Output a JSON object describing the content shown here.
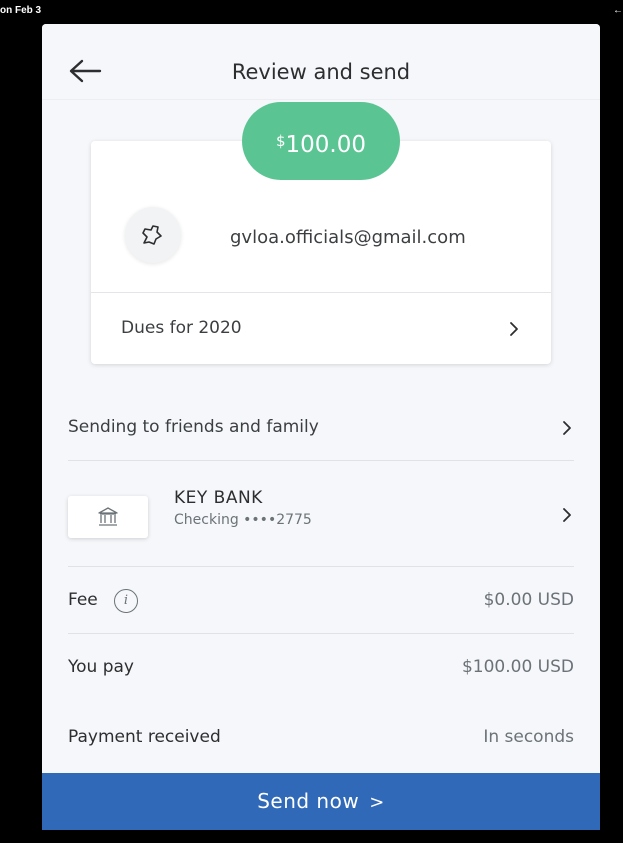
{
  "status_bar": {
    "left": "on Feb 3",
    "right": "←"
  },
  "header": {
    "title": "Review and send"
  },
  "amount": {
    "currency": "$",
    "value": "100.00"
  },
  "recipient": {
    "email": "gvloa.officials@gmail.com"
  },
  "note": {
    "text": "Dues for 2020"
  },
  "sending_type": {
    "label": "Sending to friends and family"
  },
  "payment_method": {
    "bank_name": "KEY BANK",
    "account": "Checking ••••2775"
  },
  "fee": {
    "label": "Fee",
    "info_glyph": "i",
    "value": "$0.00 USD"
  },
  "you_pay": {
    "label": "You pay",
    "value": "$100.00 USD"
  },
  "payment_received": {
    "label": "Payment received",
    "value": "In seconds"
  },
  "send_button": {
    "label": "Send now",
    "arrow": ">"
  },
  "colors": {
    "amount_green": "#5bc493",
    "send_blue": "#3069b7",
    "background": "#f5f7fa"
  }
}
